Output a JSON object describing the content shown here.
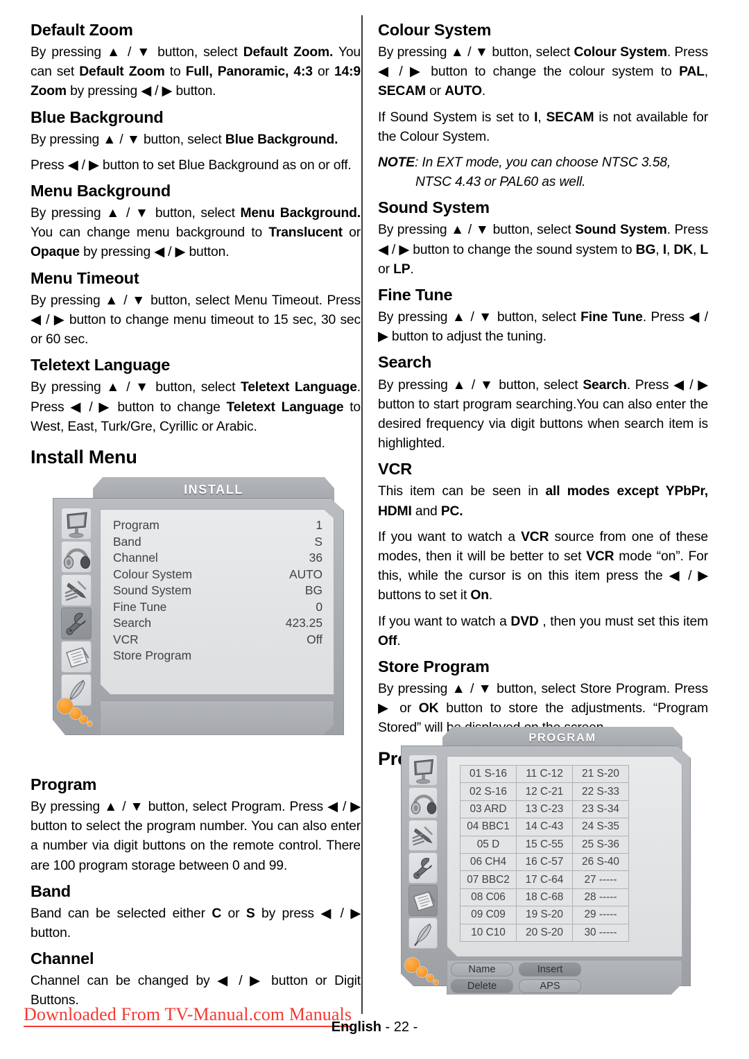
{
  "page": {
    "language_label": "English",
    "page_number": "- 22 -",
    "watermark": "Downloaded From TV-Manual.com Manuals",
    "watermark_color": "#f4392f"
  },
  "left_column": {
    "sections": [
      {
        "heading": "Default Zoom",
        "paragraphs": [
          "By pressing ▲ / ▼ button, select <b>Default Zoom.</b> You can set <b>Default Zoom</b> to <b>Full, Panoramic, 4:3</b> or <b>14:9 Zoom</b> by pressing ◀ / ▶ button."
        ]
      },
      {
        "heading": "Blue Background",
        "paragraphs": [
          "By pressing ▲ / ▼ button, select <b>Blue Background.</b>",
          "Press ◀ / ▶ button  to set Blue Background as on or off."
        ]
      },
      {
        "heading": "Menu Background",
        "paragraphs": [
          "By pressing ▲ / ▼ button, select <b>Menu Background.</b> You can change menu background to <b>Translucent</b> or <b>Opaque</b> by pressing ◀ / ▶ button."
        ]
      },
      {
        "heading": "Menu Timeout",
        "paragraphs": [
          "By pressing ▲ / ▼ button, select Menu Timeout. Press ◀ / ▶ button to change menu timeout to 15 sec, 30 sec or 60 sec."
        ]
      },
      {
        "heading": "Teletext Language",
        "paragraphs": [
          "By pressing ▲ / ▼ button, select <b>Teletext Language</b>. Press ◀ / ▶ button to change <b>Teletext Language</b> to West, East, Turk/Gre, Cyrillic or Arabic."
        ]
      }
    ],
    "install_menu_title": "Install Menu",
    "sections_after": [
      {
        "heading": "Program",
        "paragraphs": [
          "By pressing ▲ / ▼ button, select Program. Press ◀ / ▶ button to select the program number. You can also enter a number via digit buttons on the remote control. There are 100 program storage between 0 and 99."
        ]
      },
      {
        "heading": "Band",
        "paragraphs": [
          "Band can be selected either <b>C</b> or <b>S</b> by press ◀ / ▶ button."
        ]
      },
      {
        "heading": "Channel",
        "paragraphs": [
          "Channel can be changed by ◀ / ▶ button or Digit Buttons."
        ]
      }
    ]
  },
  "right_column": {
    "sections": [
      {
        "heading": "Colour System",
        "paragraphs": [
          "By pressing ▲ / ▼ button, select <b>Colour System</b>. Press ◀ / ▶ button to change the colour system to <b>PAL</b>, <b>SECAM</b> or <b>AUTO</b>.",
          "If Sound  System is set to <b>I</b>, <b>SECAM</b> is not available for the Colour System."
        ],
        "note": "NOTE",
        "note_line1": ": In EXT mode, you can choose NTSC 3.58,",
        "note_line2": "NTSC 4.43 or PAL60 as well."
      },
      {
        "heading": "Sound System",
        "paragraphs": [
          "By pressing ▲ / ▼ button, select <b>Sound System</b>. Press ◀ / ▶ button to change the sound system to <b>BG</b>, <b>I</b>, <b>DK</b>, <b>L</b> or <b>LP</b>."
        ]
      },
      {
        "heading": "Fine Tune",
        "paragraphs": [
          "By pressing ▲ / ▼ button, select <b>Fine Tune</b>. Press ◀ / ▶ button to adjust the tuning."
        ]
      },
      {
        "heading": "Search",
        "paragraphs": [
          "By pressing ▲ / ▼ button, select <b>Search</b>. Press ◀ / ▶ button to start program searching.You can also enter the desired frequency via digit buttons when search item is highlighted."
        ]
      },
      {
        "heading": "VCR",
        "paragraphs": [
          "This item can be seen in <b>all modes except  YPbPr, HDMI</b> and <b>PC.</b>",
          "If you want to watch a <b>VCR</b> source from one of these modes, then  it will be better to set <b>VCR</b> mode “on”. For this, while the cursor is on this item press the ◀ / ▶ buttons to set it <b>On</b>.",
          "If you want to watch a <b>DVD</b> , then you must set this item <b>Off</b>."
        ]
      },
      {
        "heading": "Store Program",
        "paragraphs": [
          "By pressing ▲ / ▼ button, select Store Program. Press ▶ or <b>OK</b> button to store the adjustments. “Program Stored” will be displayed on the screen."
        ]
      }
    ],
    "program_menu_title": "Program Menu"
  },
  "install_osd": {
    "title": "INSTALL",
    "icons": [
      {
        "name": "tv-monitor-icon",
        "selected": false
      },
      {
        "name": "headphones-icon",
        "selected": false
      },
      {
        "name": "multitool-icon",
        "selected": false
      },
      {
        "name": "wrench-icon",
        "selected": true
      },
      {
        "name": "notepad-icon",
        "selected": false
      },
      {
        "name": "feather-icon",
        "selected": false
      }
    ],
    "rows": [
      {
        "label": "Program",
        "value": "1"
      },
      {
        "label": "Band",
        "value": "S"
      },
      {
        "label": "Channel",
        "value": "36"
      },
      {
        "label": "Colour System",
        "value": "AUTO"
      },
      {
        "label": "Sound System",
        "value": "BG"
      },
      {
        "label": "Fine Tune",
        "value": "0"
      },
      {
        "label": "Search",
        "value": "423.25"
      },
      {
        "label": "VCR",
        "value": "Off"
      },
      {
        "label": "Store Program",
        "value": ""
      }
    ]
  },
  "program_osd": {
    "title": "PROGRAM",
    "icons": [
      {
        "name": "tv-monitor-icon",
        "selected": false
      },
      {
        "name": "headphones-icon",
        "selected": false
      },
      {
        "name": "multitool-icon",
        "selected": false
      },
      {
        "name": "wrench-icon",
        "selected": false
      },
      {
        "name": "notepad-icon",
        "selected": true
      },
      {
        "name": "feather-icon",
        "selected": false
      }
    ],
    "table": [
      [
        "01 S-16",
        "11 C-12",
        "21 S-20"
      ],
      [
        "02 S-16",
        "12 C-21",
        "22 S-33"
      ],
      [
        "03 ARD",
        "13 C-23",
        "23 S-34"
      ],
      [
        "04 BBC1",
        "14 C-43",
        "24 S-35"
      ],
      [
        "05 D",
        "15 C-55",
        "25 S-36"
      ],
      [
        "06 CH4",
        "16 C-57",
        "26 S-40"
      ],
      [
        "07 BBC2",
        "17 C-64",
        "27 -----"
      ],
      [
        "08 C06",
        "18 C-68",
        "28 -----"
      ],
      [
        "09 C09",
        "19 S-20",
        "29 -----"
      ],
      [
        "10 C10",
        "20 S-20",
        "30 -----"
      ]
    ],
    "buttons": [
      {
        "label": "Name",
        "style": "light"
      },
      {
        "label": "Insert",
        "style": "dark"
      },
      {
        "label": "Delete",
        "style": "dark"
      },
      {
        "label": "APS",
        "style": "light"
      }
    ]
  }
}
